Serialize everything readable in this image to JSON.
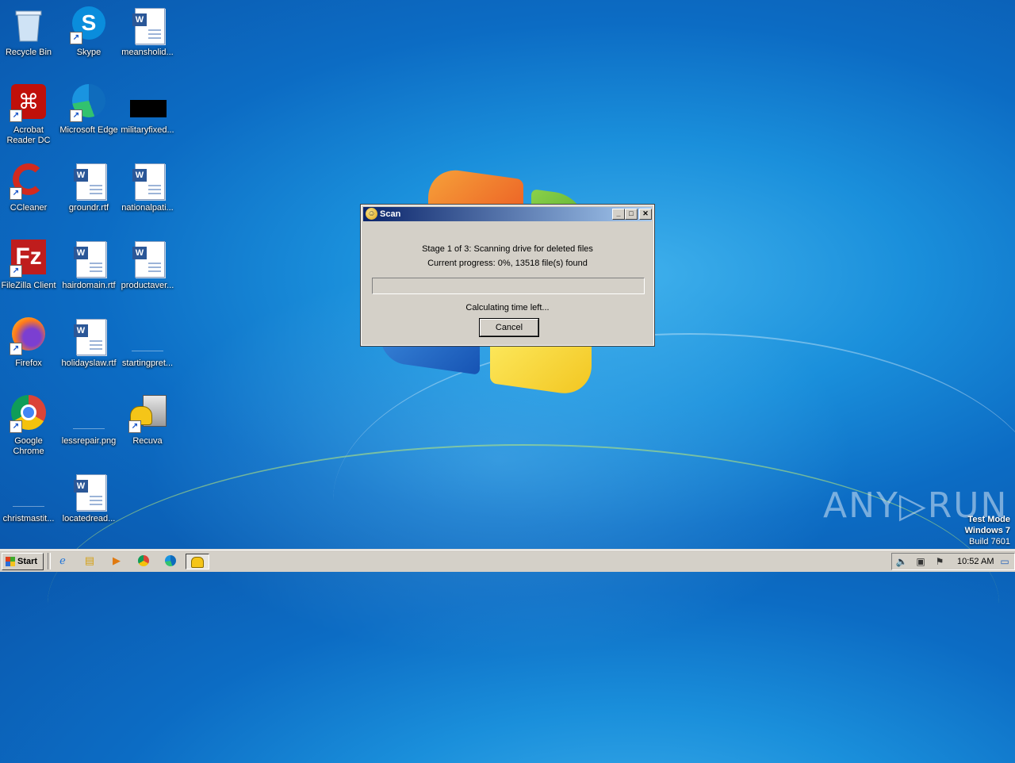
{
  "desktop": {
    "icons": [
      {
        "label": "Recycle Bin",
        "icon": "recycle-bin-icon"
      },
      {
        "label": "Skype",
        "icon": "skype-icon"
      },
      {
        "label": "meansholid...",
        "icon": "word-doc-icon"
      },
      {
        "label": "Acrobat Reader DC",
        "icon": "acrobat-icon"
      },
      {
        "label": "Microsoft Edge",
        "icon": "edge-icon"
      },
      {
        "label": "militaryfixed...",
        "icon": "black-file-icon"
      },
      {
        "label": "CCleaner",
        "icon": "ccleaner-icon"
      },
      {
        "label": "groundr.rtf",
        "icon": "word-doc-icon"
      },
      {
        "label": "nationalpati...",
        "icon": "word-doc-icon"
      },
      {
        "label": "FileZilla Client",
        "icon": "filezilla-icon"
      },
      {
        "label": "hairdomain.rtf",
        "icon": "word-doc-icon"
      },
      {
        "label": "productaver...",
        "icon": "word-doc-icon"
      },
      {
        "label": "Firefox",
        "icon": "firefox-icon"
      },
      {
        "label": "holidayslaw.rtf",
        "icon": "word-doc-icon"
      },
      {
        "label": "startingpret...",
        "icon": "blank-file-icon"
      },
      {
        "label": "Google Chrome",
        "icon": "chrome-icon"
      },
      {
        "label": "lessrepair.png",
        "icon": "blank-file-icon"
      },
      {
        "label": "Recuva",
        "icon": "recuva-icon"
      },
      {
        "label": "christmastit...",
        "icon": "blank-file-icon"
      },
      {
        "label": "locatedread...",
        "icon": "word-doc-icon"
      }
    ]
  },
  "dialog": {
    "title": "Scan",
    "title_icon": "recuva-icon",
    "stage_text": "Stage 1 of 3: Scanning drive for deleted files",
    "progress_text": "Current progress: 0%, 13518 file(s) found",
    "progress_fraction": 0,
    "time_text": "Calculating time left...",
    "cancel_label": "Cancel",
    "minimize_glyph": "_",
    "maximize_glyph": "□",
    "close_glyph": "✕"
  },
  "taskbar": {
    "start_label": "Start",
    "quick_launch": [
      "ie-icon",
      "explorer-icon",
      "media-player-icon",
      "chrome-icon",
      "edge-icon"
    ],
    "active_task_icon": "recuva-icon",
    "tray_icons": [
      "volume-icon",
      "network-icon",
      "flag-icon",
      "show-desktop-icon"
    ],
    "clock": "10:52 AM"
  },
  "watermark": {
    "brand": "ANY▷RUN",
    "line1": "Test Mode",
    "line2": "Windows 7",
    "line3": "Build 7601"
  },
  "colors": {
    "titlebar_start": "#0a246a",
    "titlebar_end": "#a6caf0",
    "dialog_bg": "#d4d0c8",
    "desktop_bg": "#1a8fdb"
  }
}
